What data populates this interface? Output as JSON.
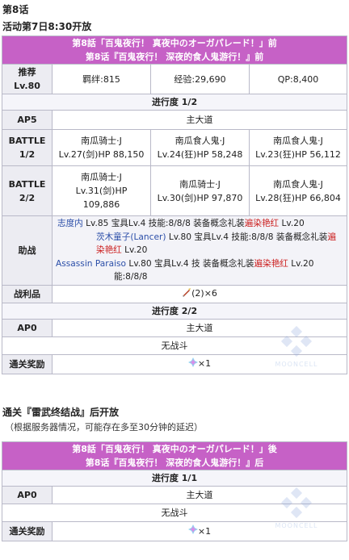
{
  "page": {
    "heading": "第8话",
    "open_time": "活动第7日8:30开放",
    "section2_heading": "通关『雷武终结战』后开放",
    "section2_note": "（根据服务器情况，可能存在多至30分钟的延迟）"
  },
  "quest1": {
    "title_jp": "第8話「百鬼夜行！ 真夜中のオーガパレード！」前",
    "title_cn": "第8话『百鬼夜行！ 深夜的食人鬼游行！』前",
    "recommend_label": "推荐\nLv.80",
    "bond": "羁绊:815",
    "exp": "经验:29,690",
    "qp": "QP:8,400",
    "progress1": "进行度 1/2",
    "ap_label1": "AP5",
    "route1": "主大道",
    "battle1_label": "BATTLE\n1/2",
    "battle1": [
      {
        "name": "南瓜骑士·J",
        "info": "Lv.27(剑)HP 88,150"
      },
      {
        "name": "南瓜食人鬼·J",
        "info": "Lv.24(狂)HP 58,248"
      },
      {
        "name": "南瓜食人鬼·J",
        "info": "Lv.23(狂)HP 56,112"
      }
    ],
    "battle2_label": "BATTLE\n2/2",
    "battle2": [
      {
        "name": "南瓜骑士·J",
        "info": "Lv.31(剑)HP\n109,886"
      },
      {
        "name": "南瓜骑士·J",
        "info": "Lv.30(剑)HP 97,870"
      },
      {
        "name": "南瓜食人鬼·J",
        "info": "Lv.28(狂)HP 66,804"
      }
    ],
    "support_label": "助战",
    "support": {
      "s1_name": "志度内",
      "s1_stats": " Lv.85 宝具Lv.4 技能:8/8/8 ",
      "s1_ce_prefix": "装备概念礼装",
      "s1_ce": "遍染艳红",
      "s1_ce_lv": " Lv.20",
      "s2_name": "茨木童子(Lancer)",
      "s2_stats": " Lv.80 宝具Lv.4 技能:8/8/8 ",
      "s2_ce_prefix": "装备概念礼装",
      "s2_ce": "遍染艳红",
      "s2_ce_lv": " Lv.20",
      "s3_name": "Assassin Paraiso",
      "s3_stats": " Lv.80 宝具Lv.4 技",
      "s3_ce_prefix": "装备概念礼装",
      "s3_ce": "遍染艳红",
      "s3_ce_lv": " Lv.20",
      "s3_tail": "能:8/8/8"
    },
    "drops_label": "战利品",
    "drops_value": "(2)×6",
    "progress2": "进行度 2/2",
    "ap_label2": "AP0",
    "route2": "主大道",
    "no_battle": "无战斗",
    "reward_label": "通关奖励",
    "reward_value": "×1"
  },
  "quest2": {
    "title_jp": "第8話「百鬼夜行！ 真夜中のオーガパレード！」後",
    "title_cn": "第8话『百鬼夜行！ 深夜的食人鬼游行！』后",
    "progress": "进行度 1/1",
    "ap_label": "AP0",
    "route": "主大道",
    "no_battle": "无战斗",
    "reward_label": "通关奖励",
    "reward_value": "×1"
  },
  "watermark_text": "MOONCELL",
  "colors": {
    "title_bg": "#c661c6",
    "header_bg": "#ececf2",
    "link": "#2b4ea8",
    "ce_red": "#c22222"
  }
}
